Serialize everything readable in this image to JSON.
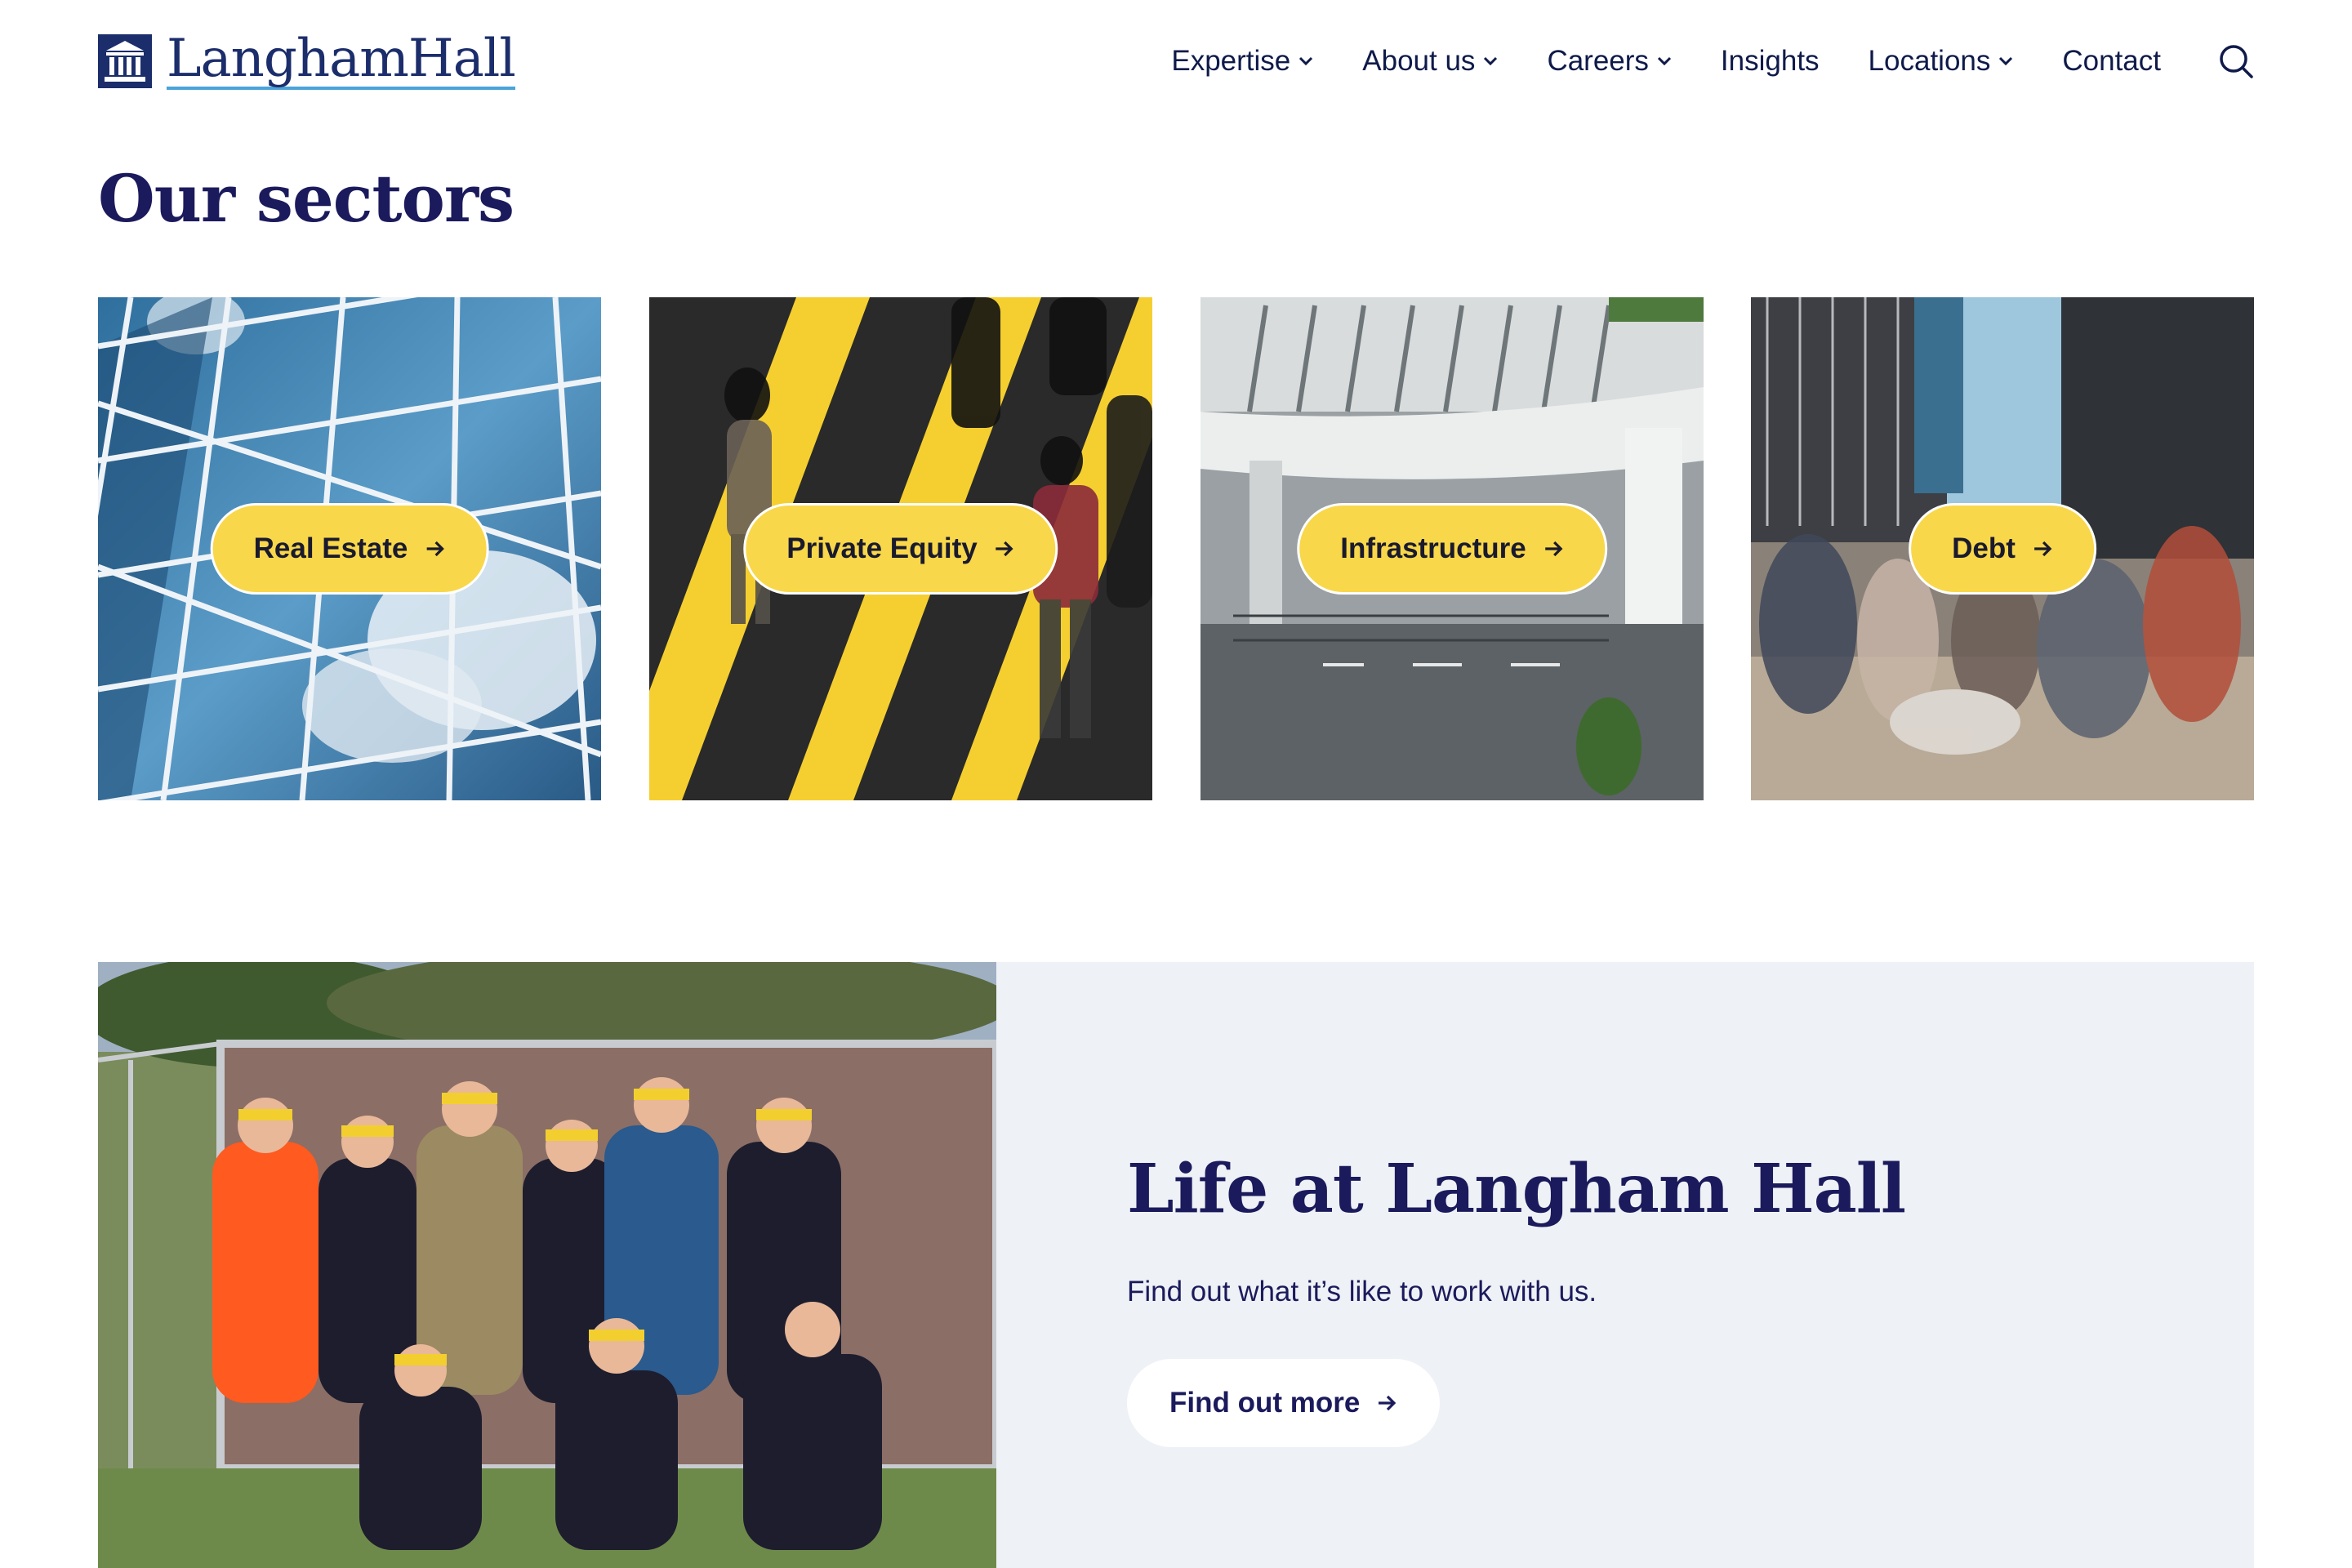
{
  "brand": {
    "name": "LanghamHall"
  },
  "nav": {
    "items": [
      {
        "label": "Expertise",
        "has_dropdown": true
      },
      {
        "label": "About us",
        "has_dropdown": true
      },
      {
        "label": "Careers",
        "has_dropdown": true
      },
      {
        "label": "Insights",
        "has_dropdown": false
      },
      {
        "label": "Locations",
        "has_dropdown": true
      },
      {
        "label": "Contact",
        "has_dropdown": false
      }
    ],
    "search_icon": "search-icon"
  },
  "sectors": {
    "title": "Our sectors",
    "cards": [
      {
        "label": "Real Estate",
        "icon": "arrow-right-icon"
      },
      {
        "label": "Private Equity",
        "icon": "arrow-right-icon"
      },
      {
        "label": "Infrastructure",
        "icon": "arrow-right-icon"
      },
      {
        "label": "Debt",
        "icon": "arrow-right-icon"
      }
    ]
  },
  "life": {
    "title": "Life at Langham Hall",
    "description": "Find out what it’s like to work with us.",
    "button_label": "Find out more"
  },
  "colors": {
    "navy": "#1b1a5c",
    "accent_yellow": "#f8d74a",
    "panel_bg": "#eef1f5",
    "logo_blue": "#1b2d6b"
  }
}
